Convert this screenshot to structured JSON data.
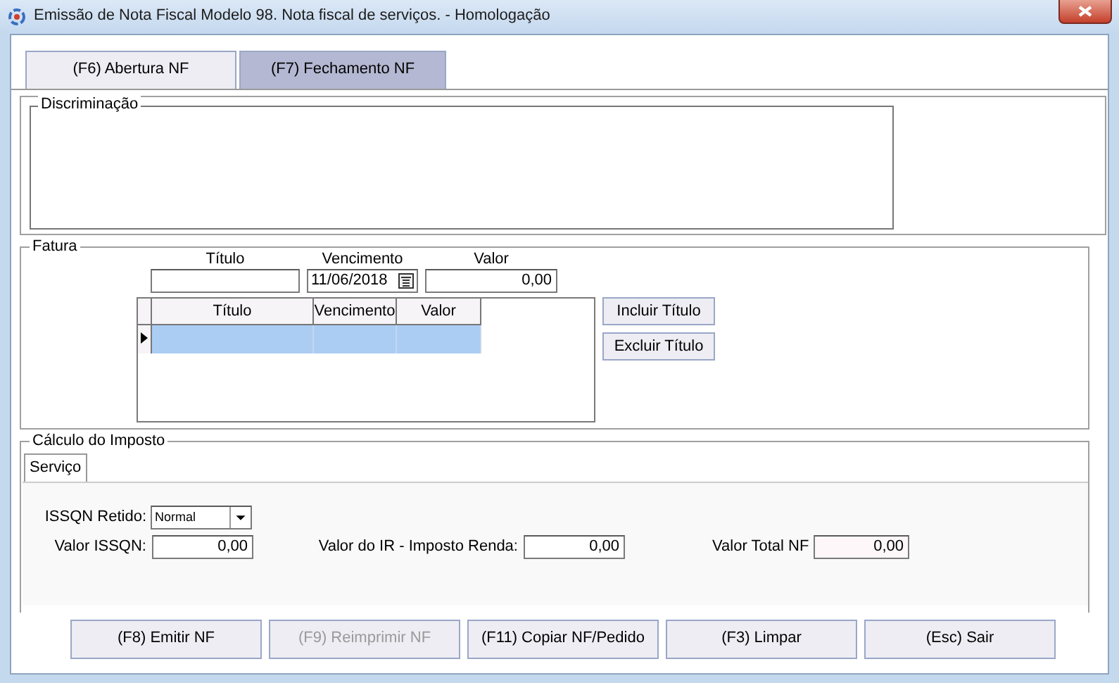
{
  "window": {
    "title": "Emissão de Nota Fiscal Modelo 98. Nota fiscal  de serviços. - Homologação"
  },
  "tabs": [
    {
      "label": "(F6) Abertura NF",
      "selected": false
    },
    {
      "label": "(F7) Fechamento NF",
      "selected": true
    }
  ],
  "discriminacao": {
    "legend": "Discriminação"
  },
  "fatura": {
    "legend": "Fatura",
    "fields": [
      {
        "label": "Título"
      },
      {
        "label": "Vencimento",
        "value": "11/06/2018",
        "kind": "date"
      },
      {
        "label": "Valor",
        "value": "0,00"
      }
    ],
    "grid": {
      "columns": [
        "Título",
        "Vencimento",
        "Valor"
      ],
      "rows": [
        {
          "selected": true
        }
      ]
    },
    "buttons": [
      "Incluir Título",
      "Excluir Título"
    ]
  },
  "calculo": {
    "legend": "Cálculo do Imposto",
    "tabs": [
      {
        "label": "Serviço",
        "selected": true
      }
    ],
    "issqn_retido": {
      "label": "ISSQN Retido:",
      "value": "Normal"
    },
    "fields": [
      {
        "label": "Valor ISSQN:",
        "value": "0,00"
      },
      {
        "label": "Valor do IR - Imposto Renda:",
        "value": "0,00"
      },
      {
        "label": "Valor Total NF",
        "value": "0,00"
      }
    ]
  },
  "buttons": [
    {
      "label": "(F8) Emitir NF",
      "disabled": false
    },
    {
      "label": "(F9) Reimprimir NF",
      "disabled": true
    },
    {
      "label": "(F11) Copiar NF/Pedido",
      "disabled": false
    },
    {
      "label": "(F3) Limpar",
      "disabled": false
    },
    {
      "label": "(Esc) Sair",
      "disabled": false
    }
  ]
}
